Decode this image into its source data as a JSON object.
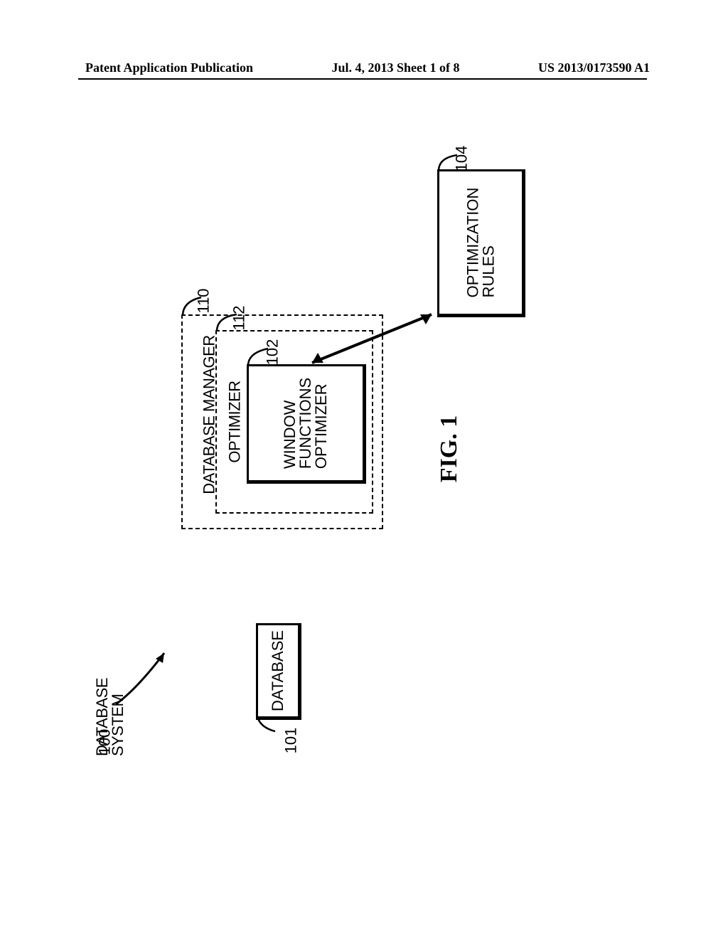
{
  "header": {
    "left": "Patent Application Publication",
    "center": "Jul. 4, 2013   Sheet 1 of 8",
    "right": "US 2013/0173590 A1"
  },
  "figure_label": "FIG. 1",
  "blocks": {
    "database_system": "DATABASE\nSYSTEM",
    "database": "DATABASE",
    "database_manager": "DATABASE MANAGER",
    "optimizer": "OPTIMIZER",
    "window_functions_optimizer": "WINDOW\nFUNCTIONS\nOPTIMIZER",
    "optimization_rules": "OPTIMIZATION\nRULES"
  },
  "refs": {
    "100": "100",
    "101": "101",
    "110": "110",
    "112": "112",
    "102": "102",
    "104": "104"
  }
}
